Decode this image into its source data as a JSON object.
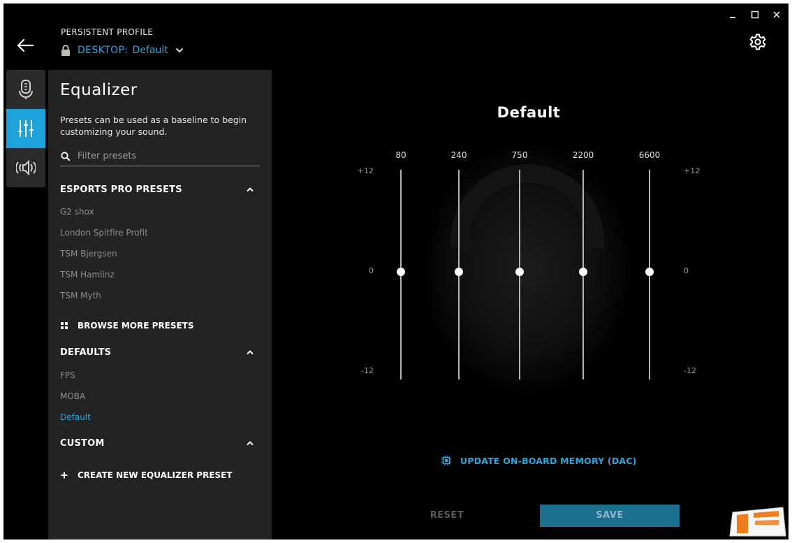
{
  "header": {
    "kicker": "PERSISTENT PROFILE",
    "profile_prefix": "DESKTOP:",
    "profile_name": "Default"
  },
  "panel": {
    "title": "Equalizer",
    "description": "Presets can be used as a baseline to begin customizing your sound.",
    "filter_placeholder": "Filter presets",
    "sections": [
      {
        "title": "ESPORTS PRO PRESETS",
        "items": [
          "G2 shox",
          "London Spitfire Profit",
          "TSM Bjergsen",
          "TSM Hamlinz",
          "TSM Myth"
        ]
      },
      {
        "title": "DEFAULTS",
        "items": [
          "FPS",
          "MOBA",
          "Default"
        ]
      },
      {
        "title": "CUSTOM",
        "items": []
      }
    ],
    "browse_more": "BROWSE MORE PRESETS",
    "create_new": "CREATE NEW EQUALIZER PRESET",
    "active_preset": "Default"
  },
  "equalizer": {
    "preset_name": "Default",
    "scale_top": "+12",
    "scale_mid": "0",
    "scale_bottom": "-12",
    "bands": [
      {
        "freq": "80",
        "gain": 0
      },
      {
        "freq": "240",
        "gain": 0
      },
      {
        "freq": "750",
        "gain": 0
      },
      {
        "freq": "2200",
        "gain": 0
      },
      {
        "freq": "6600",
        "gain": 0
      }
    ]
  },
  "actions": {
    "update_memory": "UPDATE ON-BOARD MEMORY (DAC)",
    "reset": "RESET",
    "save": "SAVE"
  },
  "colors": {
    "accent": "#2aa7e0",
    "rail_active": "#1ea2dc",
    "save_bg": "#1b6f8f",
    "panel_bg": "#232323"
  }
}
